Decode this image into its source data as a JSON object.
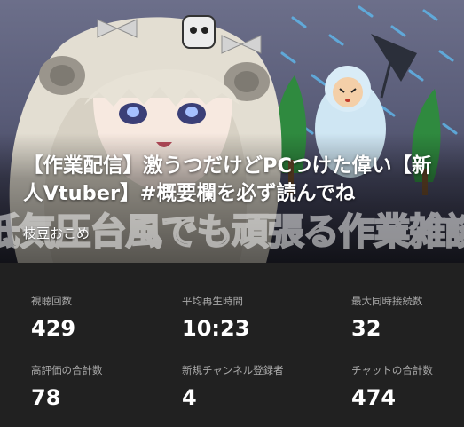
{
  "video": {
    "title": "【作業配信】激うつだけどPCつけた偉い【新人Vtuber】#概要欄を必ず読んでね",
    "channel": "枝豆おこめ",
    "banner_text": "低気圧台風でも頑張る作業雑談"
  },
  "stats": [
    {
      "label": "視聴回数",
      "value": "429"
    },
    {
      "label": "平均再生時間",
      "value": "10:23"
    },
    {
      "label": "最大同時接続数",
      "value": "32"
    },
    {
      "label": "高評価の合計数",
      "value": "78"
    },
    {
      "label": "新規チャンネル登録者",
      "value": "4"
    },
    {
      "label": "チャットの合計数",
      "value": "474"
    }
  ]
}
